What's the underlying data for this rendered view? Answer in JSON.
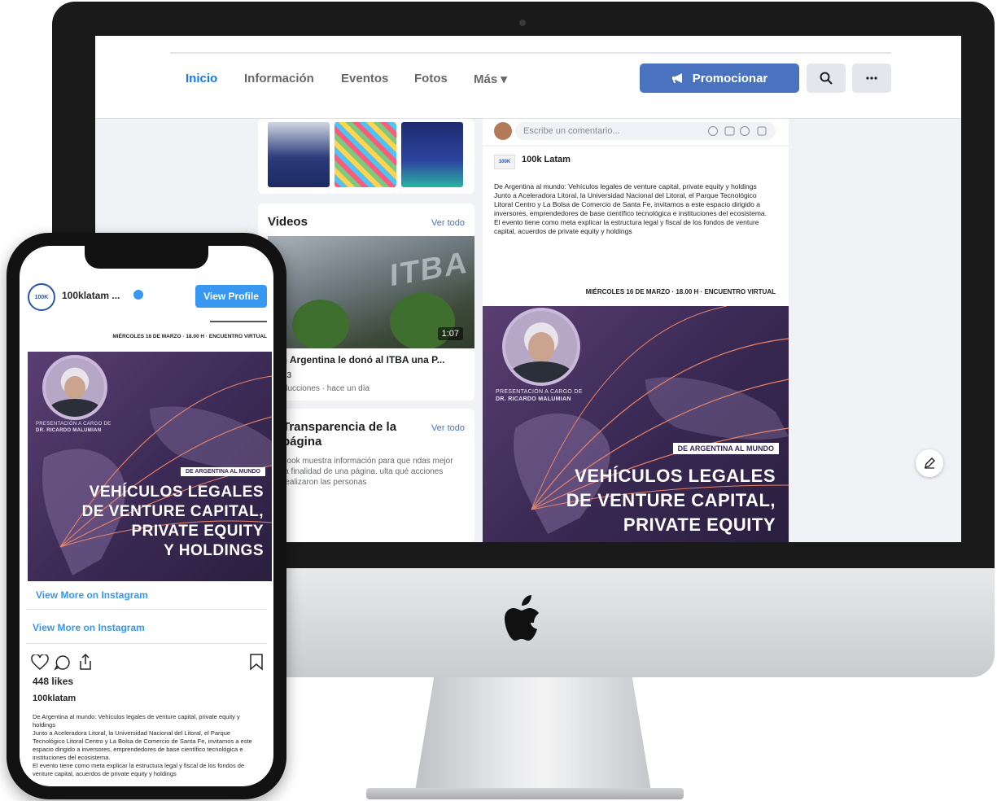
{
  "facebook": {
    "nav": {
      "tabs": [
        "Inicio",
        "Información",
        "Eventos",
        "Fotos",
        "Más ▾"
      ],
      "promote_label": "Promocionar"
    },
    "videos": {
      "title": "Videos",
      "see_all": "Ver todo",
      "video_title": "an Argentina le donó al ITBA una P...",
      "duration": "1:07",
      "reactions": "13",
      "meta": "roducciones · hace un día",
      "thumb_text": "ITBA"
    },
    "transparency": {
      "title": "Transparencia de la página",
      "see_all": "Ver todo",
      "body": "book muestra información para que ndas mejor la finalidad de una página. ulta qué acciones realizaron las personas"
    },
    "comment_placeholder": "Escribe un comentario...",
    "post": {
      "page_name": "100k Latam",
      "body": "De Argentina al mundo: Vehículos legales de venture capital, private equity y holdings\nJunto a Aceleradora Litoral, la Universidad Nacional del Litoral, el Parque Tecnológico Litoral Centro y La Bolsa de Comercio de Santa Fe, invitamos a este espacio dirigido a inversores, emprendedores de base científico tecnológica e instituciones del ecosistema.\nEl evento tiene como meta explicar la estructura legal y fiscal de los fondos de venture capital, acuerdos de private equity y holdings",
      "event_line": "MIÉRCOLES 16 DE MARZO · 18.00 H · ENCUENTRO VIRTUAL",
      "tag": "DE ARGENTINA AL MUNDO",
      "headline": [
        "VEHÍCULOS LEGALES",
        "DE VENTURE CAPITAL,",
        "PRIVATE EQUITY"
      ],
      "speaker": [
        "PRESENTACIÓN A CARGO DE",
        "DR. RICARDO MALUMIAN"
      ]
    }
  },
  "instagram": {
    "username": "100klatam ...",
    "avatar_text": "100K",
    "view_profile": "View Profile",
    "event_line": "MIÉRCOLES 16 DE MARZO · 18.00 H · ENCUENTRO VIRTUAL",
    "tag": "DE ARGENTINA AL MUNDO",
    "headline": [
      "VEHÍCULOS LEGALES",
      "DE VENTURE CAPITAL,",
      "PRIVATE EQUITY",
      "Y HOLDINGS"
    ],
    "speaker": [
      "PRESENTACIÓN A CARGO DE",
      "DR. RICARDO MALUMIAN"
    ],
    "view_more_1": "View More on Instagram",
    "view_more_2": "View More on Instagram",
    "likes": "448 likes",
    "caption_user": "100klatam",
    "caption": "De Argentina al mundo: Vehículos legales de venture capital, private equity y holdings\nJunto a Aceleradora Litoral, la Universidad Nacional del Litoral, el Parque Tecnológico Litoral Centro y La Bolsa de Comercio de Santa Fe, invitamos a este espacio dirigido a inversores, emprendedores de base científico tecnológica e instituciones del ecosistema.\nEl evento tiene como meta explicar la estructura legal y fiscal de los fondos de venture capital, acuerdos de private equity y holdings"
  },
  "colors": {
    "fb_blue": "#4a73bf",
    "ig_blue": "#3897f0",
    "post_purple": "#3b2a55"
  }
}
